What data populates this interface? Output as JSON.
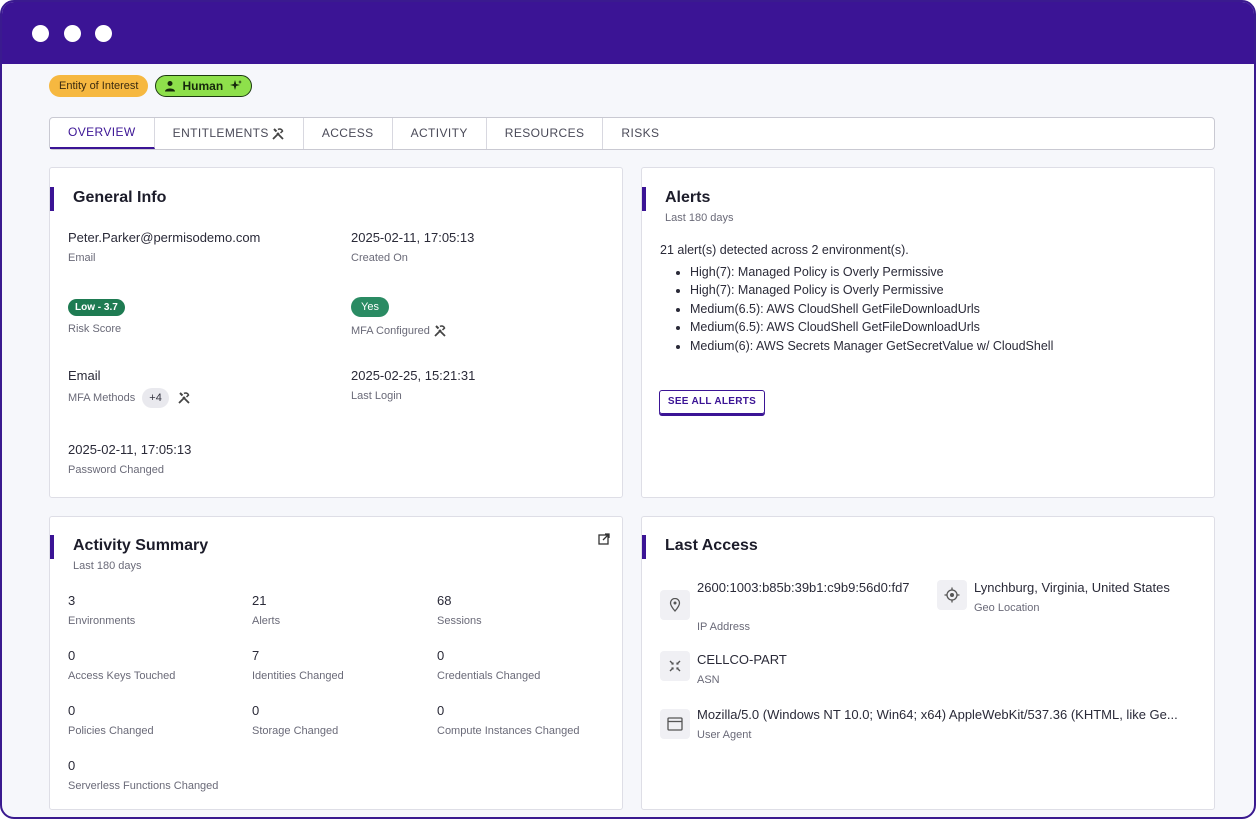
{
  "badges": {
    "entity": "Entity of Interest",
    "human": "Human"
  },
  "tabs": [
    {
      "label": "OVERVIEW",
      "active": true
    },
    {
      "label": "ENTITLEMENTS",
      "active": false
    },
    {
      "label": "ACCESS",
      "active": false
    },
    {
      "label": "ACTIVITY",
      "active": false
    },
    {
      "label": "RESOURCES",
      "active": false
    },
    {
      "label": "RISKS",
      "active": false
    }
  ],
  "general_info": {
    "title": "General Info",
    "email_value": "Peter.Parker@permisodemo.com",
    "email_label": "Email",
    "created_value": "2025-02-11, 17:05:13",
    "created_label": "Created On",
    "risk_value": "Low - 3.7",
    "risk_label": "Risk Score",
    "mfa_value": "Yes",
    "mfa_label": "MFA Configured",
    "methods_value": "Email",
    "methods_label": "MFA Methods",
    "methods_more": "+4",
    "last_login_value": "2025-02-25, 15:21:31",
    "last_login_label": "Last Login",
    "pwd_value": "2025-02-11, 17:05:13",
    "pwd_label": "Password Changed"
  },
  "alerts": {
    "title": "Alerts",
    "subtitle": "Last 180 days",
    "summary": "21 alert(s) detected across 2 environment(s).",
    "items": [
      "High(7): Managed Policy is Overly Permissive",
      "High(7): Managed Policy is Overly Permissive",
      "Medium(6.5): AWS CloudShell GetFileDownloadUrls",
      "Medium(6.5): AWS CloudShell GetFileDownloadUrls",
      "Medium(6): AWS Secrets Manager GetSecretValue w/ CloudShell"
    ],
    "button": "SEE ALL ALERTS"
  },
  "activity": {
    "title": "Activity Summary",
    "subtitle": "Last 180 days",
    "stats": [
      {
        "value": "3",
        "label": "Environments"
      },
      {
        "value": "21",
        "label": "Alerts"
      },
      {
        "value": "68",
        "label": "Sessions"
      },
      {
        "value": "0",
        "label": "Access Keys Touched"
      },
      {
        "value": "7",
        "label": "Identities Changed"
      },
      {
        "value": "0",
        "label": "Credentials Changed"
      },
      {
        "value": "0",
        "label": "Policies Changed"
      },
      {
        "value": "0",
        "label": "Storage Changed"
      },
      {
        "value": "0",
        "label": "Compute Instances Changed"
      },
      {
        "value": "0",
        "label": "Serverless Functions Changed"
      }
    ]
  },
  "last_access": {
    "title": "Last Access",
    "ip_value": "2600:1003:b85b:39b1:c9b9:56d0:fd7",
    "ip_label": "IP Address",
    "geo_value": "Lynchburg, Virginia, United States",
    "geo_label": "Geo Location",
    "asn_value": "CELLCO-PART",
    "asn_label": "ASN",
    "ua_value": "Mozilla/5.0 (Windows NT 10.0; Win64; x64) AppleWebKit/537.36 (KHTML, like Ge...",
    "ua_label": "User Agent"
  },
  "icons": {
    "tools": "tools-icon",
    "person": "person-icon",
    "sparkle": "sparkle-icon",
    "external": "external-link-icon",
    "pin": "location-pin-icon",
    "target": "geo-target-icon",
    "asn": "network-icon",
    "browser": "browser-window-icon"
  },
  "colors": {
    "brand": "#3b1495",
    "entity_badge": "#f6b840",
    "human_badge": "#8ee04b",
    "risk_low": "#1e7b52"
  }
}
